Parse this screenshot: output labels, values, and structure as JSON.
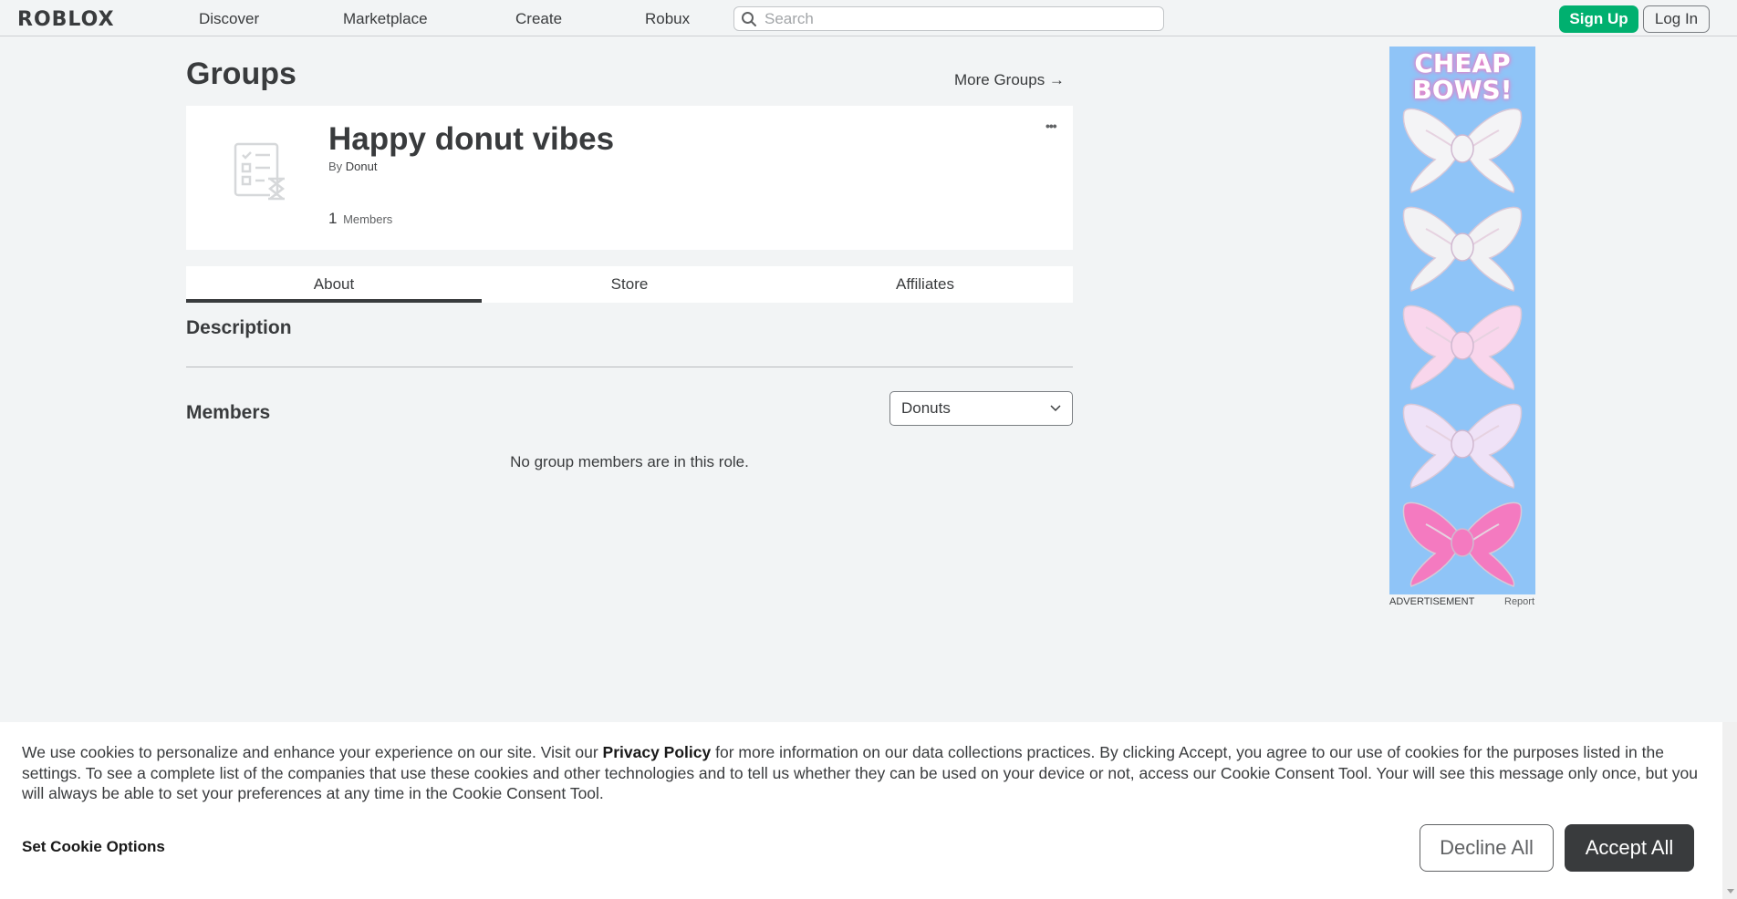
{
  "topbar": {
    "logo": "ROBLOX",
    "nav": [
      "Discover",
      "Marketplace",
      "Create",
      "Robux"
    ],
    "search_placeholder": "Search",
    "signup_label": "Sign Up",
    "login_label": "Log In"
  },
  "page": {
    "title": "Groups",
    "more_groups": "More Groups →"
  },
  "group": {
    "name": "Happy donut vibes",
    "by_prefix": "By",
    "owner": "Donut",
    "member_count": "1",
    "members_label": "Members",
    "more_menu": "•••"
  },
  "tabs": [
    "About",
    "Store",
    "Affiliates"
  ],
  "about": {
    "description_title": "Description",
    "members_title": "Members",
    "role_selected": "Donuts",
    "no_members": "No group members are in this role."
  },
  "ad": {
    "headline_line1": "CHEAP",
    "headline_line2": "BOWS!",
    "label": "ADVERTISEMENT",
    "report": "Report",
    "bow_colors": [
      "#f4f4f6",
      "#f2f2f4",
      "#f9d6ec",
      "#efe2f7",
      "#f47ac0"
    ]
  },
  "cookie": {
    "text_before": "We use cookies to personalize and enhance your experience on our site. Visit our ",
    "link": "Privacy Policy",
    "text_after": " for more information on our data collections practices. By clicking Accept, you agree to our use of cookies for the purposes listed in the settings. To see a complete list of the companies that use these cookies and other technologies and to tell us whether they can be used on your device or not, access our Cookie Consent Tool. Your will see this message only once, but you will always be able to set your preferences at any time in the Cookie Consent Tool.",
    "options_label": "Set Cookie Options",
    "decline_label": "Decline All",
    "accept_label": "Accept All"
  },
  "colors": {
    "brand_green": "#00b06f",
    "text_dark": "#393b3d",
    "ad_bg": "#8fc4f7"
  }
}
